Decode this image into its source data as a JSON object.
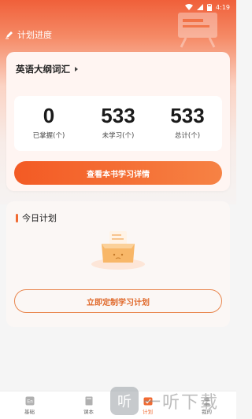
{
  "status_bar": {
    "time": "4:19"
  },
  "header": {
    "title": "计划进度"
  },
  "book": {
    "title": "英语大纲词汇"
  },
  "stats": [
    {
      "value": "0",
      "label": "已掌握(个)"
    },
    {
      "value": "533",
      "label": "未学习(个)"
    },
    {
      "value": "533",
      "label": "总计(个)"
    }
  ],
  "primary_button": "查看本书学习详情",
  "plan": {
    "title": "今日计划",
    "button": "立即定制学习计划"
  },
  "tabs": [
    {
      "label": "基础",
      "icon": "en-icon",
      "active": false
    },
    {
      "label": "课本",
      "icon": "book-icon",
      "active": false
    },
    {
      "label": "计划",
      "icon": "plan-icon",
      "active": true
    },
    {
      "label": "我的",
      "icon": "profile-icon",
      "active": false
    }
  ],
  "watermark": {
    "logo": "听",
    "text": "一听下载"
  },
  "colors": {
    "accent": "#f06a32",
    "accent_dark": "#f35a24",
    "outline": "#e9874f"
  }
}
